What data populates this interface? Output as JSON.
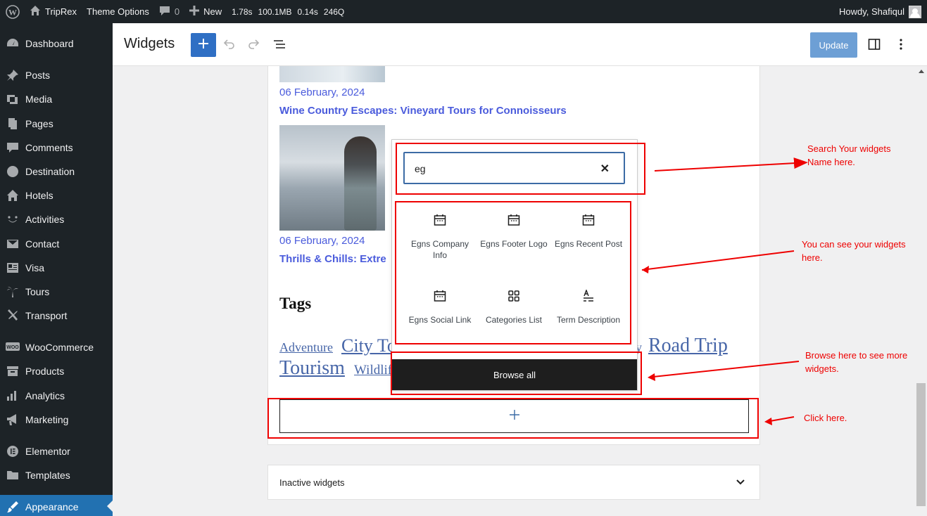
{
  "admin_bar": {
    "site_name": "TripRex",
    "theme_options": "Theme Options",
    "comments_count": "0",
    "new_label": "New",
    "stats": [
      "1.78s",
      "100.1MB",
      "0.14s",
      "246Q"
    ],
    "greeting": "Howdy, Shafiqul"
  },
  "sidebar": {
    "items": [
      {
        "label": "Dashboard",
        "icon": "dashboard-icon"
      },
      {
        "label": "Posts",
        "icon": "pin-icon"
      },
      {
        "label": "Media",
        "icon": "media-icon"
      },
      {
        "label": "Pages",
        "icon": "pages-icon"
      },
      {
        "label": "Comments",
        "icon": "comment-icon"
      },
      {
        "label": "Destination",
        "icon": "globe-icon"
      },
      {
        "label": "Hotels",
        "icon": "home-icon"
      },
      {
        "label": "Activities",
        "icon": "smile-icon"
      },
      {
        "label": "Contact",
        "icon": "mail-icon"
      },
      {
        "label": "Visa",
        "icon": "id-card-icon"
      },
      {
        "label": "Tours",
        "icon": "palm-icon"
      },
      {
        "label": "Transport",
        "icon": "plane-icon"
      },
      {
        "label": "WooCommerce",
        "icon": "woo-icon"
      },
      {
        "label": "Products",
        "icon": "archive-icon"
      },
      {
        "label": "Analytics",
        "icon": "chart-icon"
      },
      {
        "label": "Marketing",
        "icon": "megaphone-icon"
      },
      {
        "label": "Elementor",
        "icon": "elementor-icon"
      },
      {
        "label": "Templates",
        "icon": "folder-icon"
      },
      {
        "label": "Appearance",
        "icon": "brush-icon"
      }
    ]
  },
  "header": {
    "title": "Widgets",
    "update_label": "Update"
  },
  "posts": [
    {
      "date": "06 February, 2024",
      "title": "Wine Country Escapes: Vineyard Tours for Connoisseurs"
    },
    {
      "date": "06 February, 2024",
      "title": "Thrills & Chills: Extre"
    }
  ],
  "tags": {
    "heading": "Tags",
    "items": [
      "Adventure",
      "City To",
      "y",
      "Road Trip",
      "Tourism",
      "Wildlif"
    ]
  },
  "inserter": {
    "search_value": "eg",
    "clear_symbol": "✕",
    "blocks": [
      {
        "label": "Egns Company Info",
        "icon": "calendar-icon"
      },
      {
        "label": "Egns Footer Logo",
        "icon": "calendar-icon"
      },
      {
        "label": "Egns Recent Post",
        "icon": "calendar-icon"
      },
      {
        "label": "Egns Social Link",
        "icon": "calendar-icon"
      },
      {
        "label": "Categories List",
        "icon": "grid-icon"
      },
      {
        "label": "Term Description",
        "icon": "text-icon"
      }
    ],
    "browse_all": "Browse all"
  },
  "inactive_widgets": "Inactive widgets",
  "annotations": {
    "search": "Search Your widgets Name here.",
    "results": "You can see your widgets here.",
    "browse": "Browse here to see more widgets.",
    "click": "Click here."
  },
  "colors": {
    "annotation": "#ee0000",
    "primary": "#2f6fc4",
    "admin_bg": "#1d2327"
  }
}
